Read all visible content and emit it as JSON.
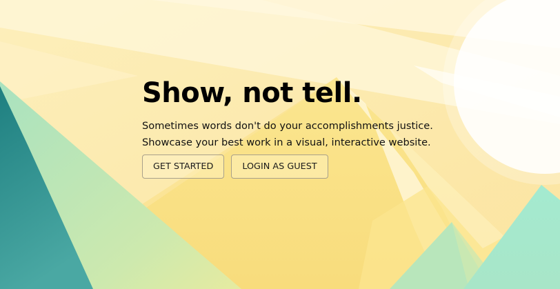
{
  "hero": {
    "title": "Show, not tell.",
    "line1": "Sometimes words don't do your accomplishments justice.",
    "line2": "Showcase your best work in a visual, interactive website."
  },
  "buttons": {
    "get_started": "GET STARTED",
    "login_guest": "LOGIN AS GUEST"
  },
  "colors": {
    "background": "#fdf0bf",
    "sun": "#ffffff",
    "mountain_dark": "#2a8585",
    "mountain_light": "#a6e8c8",
    "mountain_center": "#fbe086"
  }
}
